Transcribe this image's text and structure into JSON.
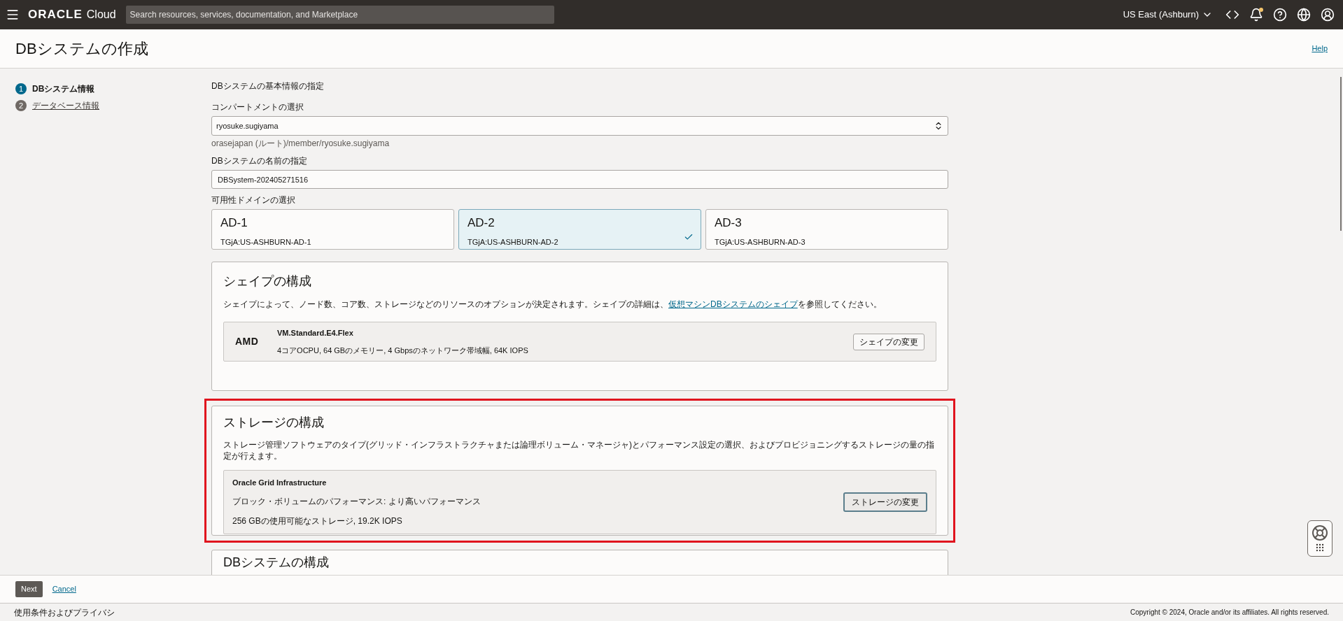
{
  "header": {
    "logo_brand": "ORACLE",
    "logo_product": "Cloud",
    "search": {
      "placeholder": "Search resources, services, documentation, and Marketplace"
    },
    "region": "US East (Ashburn)",
    "notification_dot": true
  },
  "page": {
    "title": "DBシステムの作成",
    "help": "Help"
  },
  "steps": [
    {
      "number": "1",
      "label": "DBシステム情報",
      "selected": true
    },
    {
      "number": "2",
      "label": "データベース情報",
      "selected": false
    }
  ],
  "form": {
    "section_title": "DBシステムの基本情報の指定",
    "compartment": {
      "label": "コンパートメントの選択",
      "value": "ryosuke.sugiyama",
      "hint": "orasejapan (ルート)/member/ryosuke.sugiyama"
    },
    "name": {
      "label": "DBシステムの名前の指定",
      "value": "DBSystem-202405271516"
    },
    "availability_domain": {
      "label": "可用性ドメインの選択",
      "options": [
        {
          "title": "AD-1",
          "subtitle": "TGjA:US-ASHBURN-AD-1",
          "selected": false
        },
        {
          "title": "AD-2",
          "subtitle": "TGjA:US-ASHBURN-AD-2",
          "selected": true
        },
        {
          "title": "AD-3",
          "subtitle": "TGjA:US-ASHBURN-AD-3",
          "selected": false
        }
      ]
    }
  },
  "shape": {
    "title": "シェイプの構成",
    "description_before": "シェイプによって、ノード数、コア数、ストレージなどのリソースのオプションが決定されます。シェイプの詳細は、",
    "description_link": "仮想マシンDBシステムのシェイプ",
    "description_after": "を参照してください。",
    "vendor": "AMD",
    "name": "VM.Standard.E4.Flex",
    "details": "4コアOCPU, 64 GBのメモリー, 4 Gbpsのネットワーク帯域幅, 64K IOPS",
    "button": "シェイプの変更"
  },
  "storage": {
    "title": "ストレージの構成",
    "highlighted": true,
    "description": "ストレージ管理ソフトウェアのタイプ(グリッド・インフラストラクチャまたは論理ボリューム・マネージャ)とパフォーマンス設定の選択、およびプロビジョニングするストレージの量の指定が行えます。",
    "software": "Oracle Grid Infrastructure",
    "performance": "ブロック・ボリュームのパフォーマンス: より高いパフォーマンス",
    "capacity": "256 GBの使用可能なストレージ, 19.2K IOPS",
    "button": "ストレージの変更"
  },
  "next_section": {
    "title": "DBシステムの構成"
  },
  "footer": {
    "next": "Next",
    "cancel": "Cancel"
  },
  "bottom_bar": {
    "terms": "使用条件およびプライバシ",
    "copyright": "Copyright © 2024, Oracle and/or its affiliates. All rights reserved."
  }
}
